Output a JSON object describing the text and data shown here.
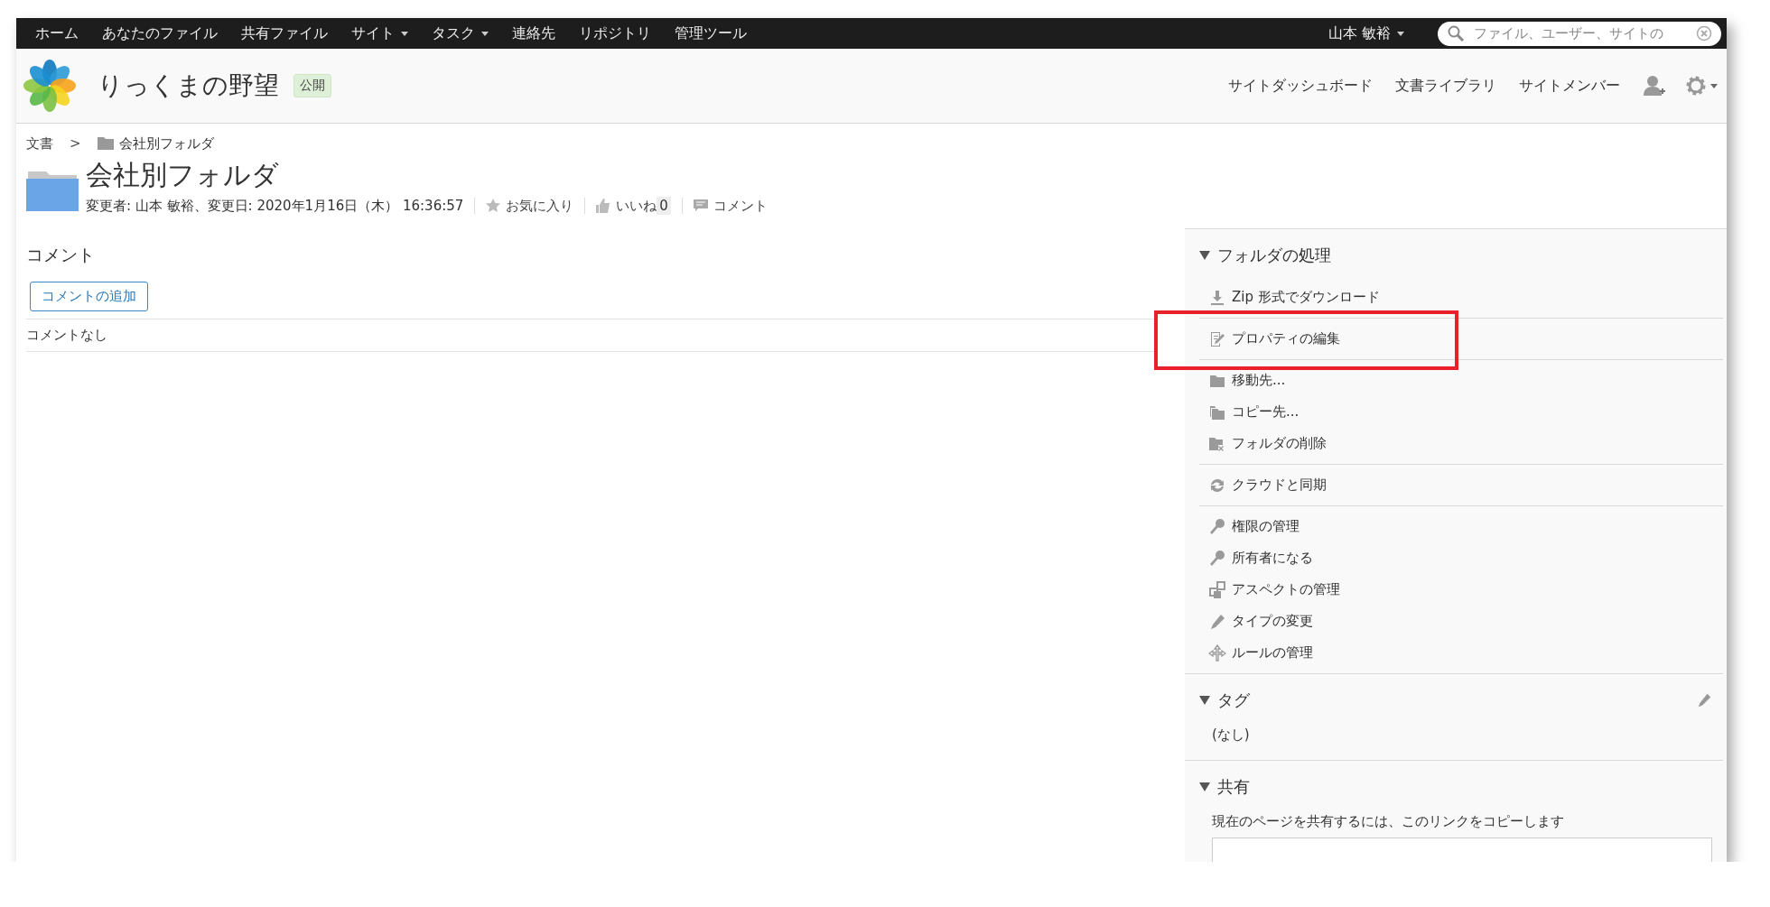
{
  "top_nav": {
    "items": [
      {
        "label": "ホーム",
        "dropdown": false
      },
      {
        "label": "あなたのファイル",
        "dropdown": false
      },
      {
        "label": "共有ファイル",
        "dropdown": false
      },
      {
        "label": "サイト",
        "dropdown": true
      },
      {
        "label": "タスク",
        "dropdown": true
      },
      {
        "label": "連絡先",
        "dropdown": false
      },
      {
        "label": "リポジトリ",
        "dropdown": false
      },
      {
        "label": "管理ツール",
        "dropdown": false
      }
    ],
    "user": {
      "name": "山本 敏裕",
      "dropdown": true
    },
    "search": {
      "placeholder": "ファイル、ユーザー、サイトの"
    }
  },
  "site": {
    "title": "りっくまの野望",
    "visibility": "公開",
    "nav": [
      "サイトダッシュボード",
      "文書ライブラリ",
      "サイトメンバー"
    ]
  },
  "breadcrumb": {
    "root": "文書",
    "separator": ">",
    "current": "会社別フォルダ"
  },
  "folder": {
    "title": "会社別フォルダ",
    "modified": "変更者: 山本 敏裕、変更日: 2020年1月16日（木） 16:36:57",
    "favorite": {
      "label": "お気に入り",
      "on": false
    },
    "like": {
      "label": "いいね",
      "count": "0",
      "on": false
    },
    "comment": "コメント"
  },
  "comments": {
    "heading": "コメント",
    "add_button": "コメントの追加",
    "empty": "コメントなし"
  },
  "panel": {
    "actions": {
      "title": "フォルダの処理",
      "expanded": true,
      "groups": [
        [
          {
            "label": "Zip 形式でダウンロード",
            "kind": "download",
            "highlighted": false
          }
        ],
        [
          {
            "label": "プロパティの編集",
            "kind": "edit",
            "highlighted": true
          }
        ],
        [
          {
            "label": "移動先...",
            "kind": "move",
            "highlighted": false
          },
          {
            "label": "コピー先...",
            "kind": "copy",
            "highlighted": false
          },
          {
            "label": "フォルダの削除",
            "kind": "delete",
            "highlighted": false
          }
        ],
        [
          {
            "label": "クラウドと同期",
            "kind": "sync",
            "highlighted": false
          }
        ],
        [
          {
            "label": "権限の管理",
            "kind": "key",
            "highlighted": false
          },
          {
            "label": "所有者になる",
            "kind": "key",
            "highlighted": false
          },
          {
            "label": "アスペクトの管理",
            "kind": "aspects",
            "highlighted": false
          },
          {
            "label": "タイプの変更",
            "kind": "pencil",
            "highlighted": false
          },
          {
            "label": "ルールの管理",
            "kind": "rules",
            "highlighted": false
          }
        ]
      ]
    },
    "tags": {
      "title": "タグ",
      "expanded": true,
      "value": "(なし)"
    },
    "share": {
      "title": "共有",
      "expanded": true,
      "text": "現在のページを共有するには、このリンクをコピーします"
    }
  }
}
